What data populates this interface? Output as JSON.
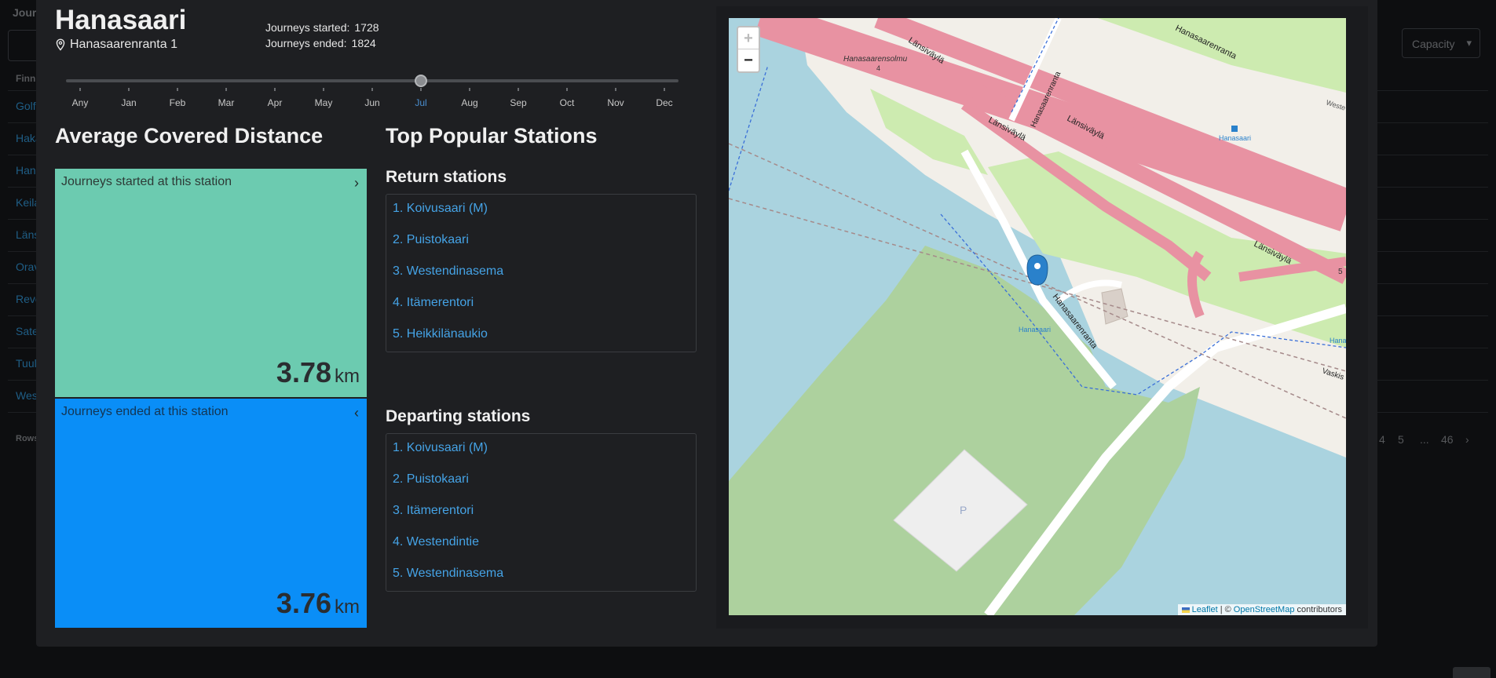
{
  "background": {
    "title": "Journ",
    "column_header": "Finni",
    "rows": [
      "Golf",
      "Haka",
      "Hana",
      "Keila",
      "Länsi",
      "Orav",
      "Revo",
      "Sate",
      "Tuul",
      "Wes"
    ],
    "rows_label": "Rows",
    "capacity_label": "Capacity",
    "pagination": [
      "4",
      "5",
      "...",
      "46"
    ]
  },
  "station": {
    "name": "Hanasaari",
    "address": "Hanasaarenranta 1",
    "journeys_started_label": "Journeys started:",
    "journeys_started": "1728",
    "journeys_ended_label": "Journeys ended:",
    "journeys_ended": "1824"
  },
  "month_filter": {
    "months": [
      "Any",
      "Jan",
      "Feb",
      "Mar",
      "Apr",
      "May",
      "Jun",
      "Jul",
      "Aug",
      "Sep",
      "Oct",
      "Nov",
      "Dec"
    ],
    "selected": "Jul",
    "selected_index": 7
  },
  "distance": {
    "heading": "Average Covered Distance",
    "started": {
      "label": "Journeys started at this station",
      "value": "3.78",
      "unit": "km"
    },
    "ended": {
      "label": "Journeys ended at this station",
      "value": "3.76",
      "unit": "km"
    }
  },
  "popular": {
    "heading": "Top Popular Stations",
    "return_heading": "Return stations",
    "return_stations": [
      "1. Koivusaari (M)",
      "2. Puistokaari",
      "3. Westendinasema",
      "4. Itämerentori",
      "5. Heikkilänaukio"
    ],
    "departing_heading": "Departing stations",
    "departing_stations": [
      "1. Koivusaari (M)",
      "2. Puistokaari",
      "3. Itämerentori",
      "4. Westendintie",
      "5. Westendinasema"
    ]
  },
  "map": {
    "zoom_in": "+",
    "zoom_out": "−",
    "labels": {
      "lansivayla": "Länsiväylä",
      "hanasaarenranta": "Hanasaarenranta",
      "hanasaarensolmu": "Hanasaarensolmu",
      "marker": "Hanasaari",
      "bus_stop": "Hanasaari",
      "parking": "P",
      "vaskis": "Vaskis",
      "weste": "Weste",
      "hana_right": "Hana",
      "exit_5": "5",
      "exit_4": "4"
    },
    "attribution": {
      "leaflet": "Leaflet",
      "separator": "| ©",
      "osm": "OpenStreetMap",
      "suffix": "contributors"
    },
    "colors": {
      "water": "#aad3df",
      "park": "#add19e",
      "grass": "#cdebb0",
      "motorway": "#e892a2",
      "land": "#f2efe9",
      "marker": "#2a81cb"
    }
  },
  "close_icon": "×"
}
